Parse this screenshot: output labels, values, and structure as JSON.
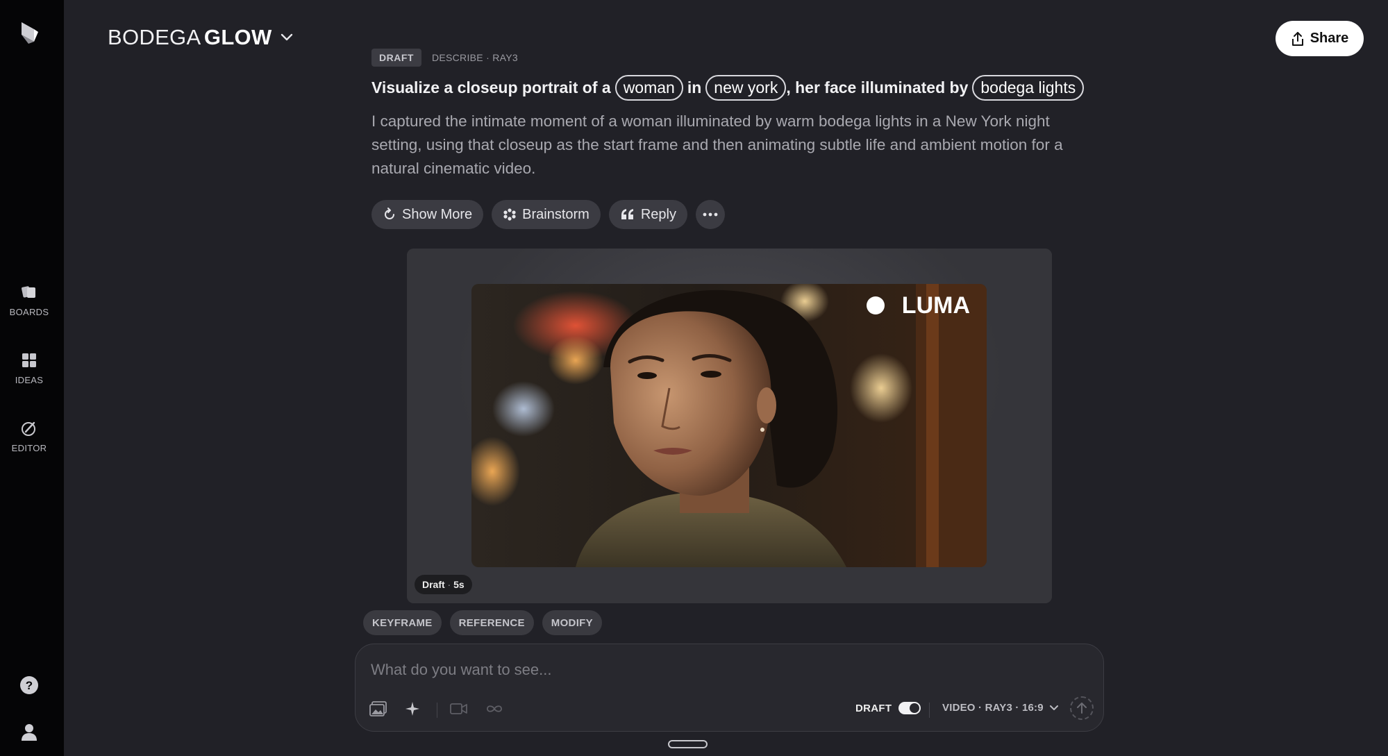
{
  "project": {
    "title_light": "BODEGA",
    "title_bold": "GLOW"
  },
  "share_label": "Share",
  "sidebar": {
    "items": [
      {
        "label": "BOARDS",
        "icon": "boards-icon"
      },
      {
        "label": "IDEAS",
        "icon": "ideas-icon"
      },
      {
        "label": "EDITOR",
        "icon": "editor-icon"
      }
    ],
    "bottom": [
      {
        "icon": "help-icon"
      },
      {
        "icon": "profile-icon"
      }
    ]
  },
  "generation": {
    "badge": "DRAFT",
    "meta": "DESCRIBE · RAY3",
    "prompt": {
      "part1": "Visualize a closeup portrait of a",
      "chip1": "woman",
      "part2": "in",
      "chip2": "new york",
      "part3": ", her face illuminated by",
      "chip3": "bodega lights"
    },
    "description": "I captured the intimate moment of a woman illuminated by warm bodega lights in a New York night setting, using that closeup as the start frame and then animating subtle life and ambient motion for a natural cinematic video.",
    "actions": {
      "show_more": "Show More",
      "brainstorm": "Brainstorm",
      "reply": "Reply"
    },
    "media": {
      "watermark": "LUMA",
      "tag_label": "Draft",
      "tag_sep": " · ",
      "tag_duration": "5s"
    }
  },
  "modes": [
    "KEYFRAME",
    "REFERENCE",
    "MODIFY"
  ],
  "composer": {
    "placeholder": "What do you want to see...",
    "draft_label": "DRAFT",
    "draft_on": true,
    "model_label": "VIDEO · RAY3 · 16:9"
  },
  "colors": {
    "background": "#212127",
    "sidebar": "#050506",
    "card": "#35353a",
    "accent": "#ffffff"
  }
}
